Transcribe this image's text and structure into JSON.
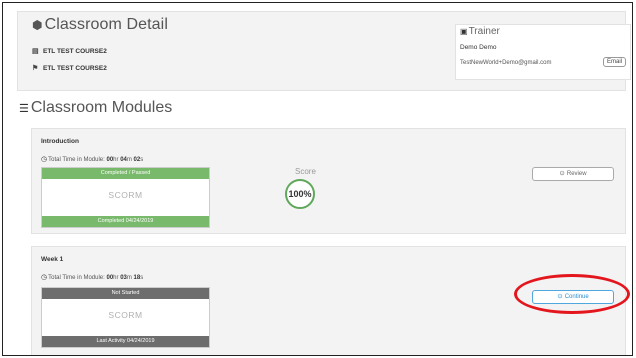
{
  "header": {
    "title": "Classroom Detail",
    "title_icon": "cube-icon",
    "course_lines": [
      {
        "icon": "book-icon",
        "text": "ETL TEST COURSE2"
      },
      {
        "icon": "flag-icon",
        "text": "ETL TEST COURSE2"
      }
    ]
  },
  "trainer": {
    "heading": "Trainer",
    "icon": "user-card-icon",
    "name": "Demo Demo",
    "email": "TestNewWorld+Demo@gmail.com",
    "email_button": "Email"
  },
  "modules_title": "Classroom Modules",
  "modules_icon": "list-icon",
  "modules": [
    {
      "name": "Introduction",
      "time_label": "Total Time in Module:",
      "time_h": "00",
      "time_h_unit": "hr",
      "time_m": "04",
      "time_m_unit": "m",
      "time_s": "02",
      "time_s_unit": "s",
      "status_top": "Completed / Passed",
      "type": "SCORM",
      "status_bottom": "Completed 04/24/2019",
      "status_color": "#79b96b",
      "score_label": "Score",
      "score_value": "100%",
      "button_label": "Review",
      "button_icon": "play-circle-icon"
    },
    {
      "name": "Week 1",
      "time_label": "Total Time in Module:",
      "time_h": "00",
      "time_h_unit": "hr",
      "time_m": "03",
      "time_m_unit": "m",
      "time_s": "18",
      "time_s_unit": "s",
      "status_top": "Not Started",
      "type": "SCORM",
      "status_bottom": "Last Activity 04/24/2019",
      "status_color": "#6d6d6d",
      "button_label": "Continue",
      "button_icon": "play-circle-icon",
      "button_color": "#2a8fd4"
    }
  ],
  "annotation_color": "#e4161d"
}
